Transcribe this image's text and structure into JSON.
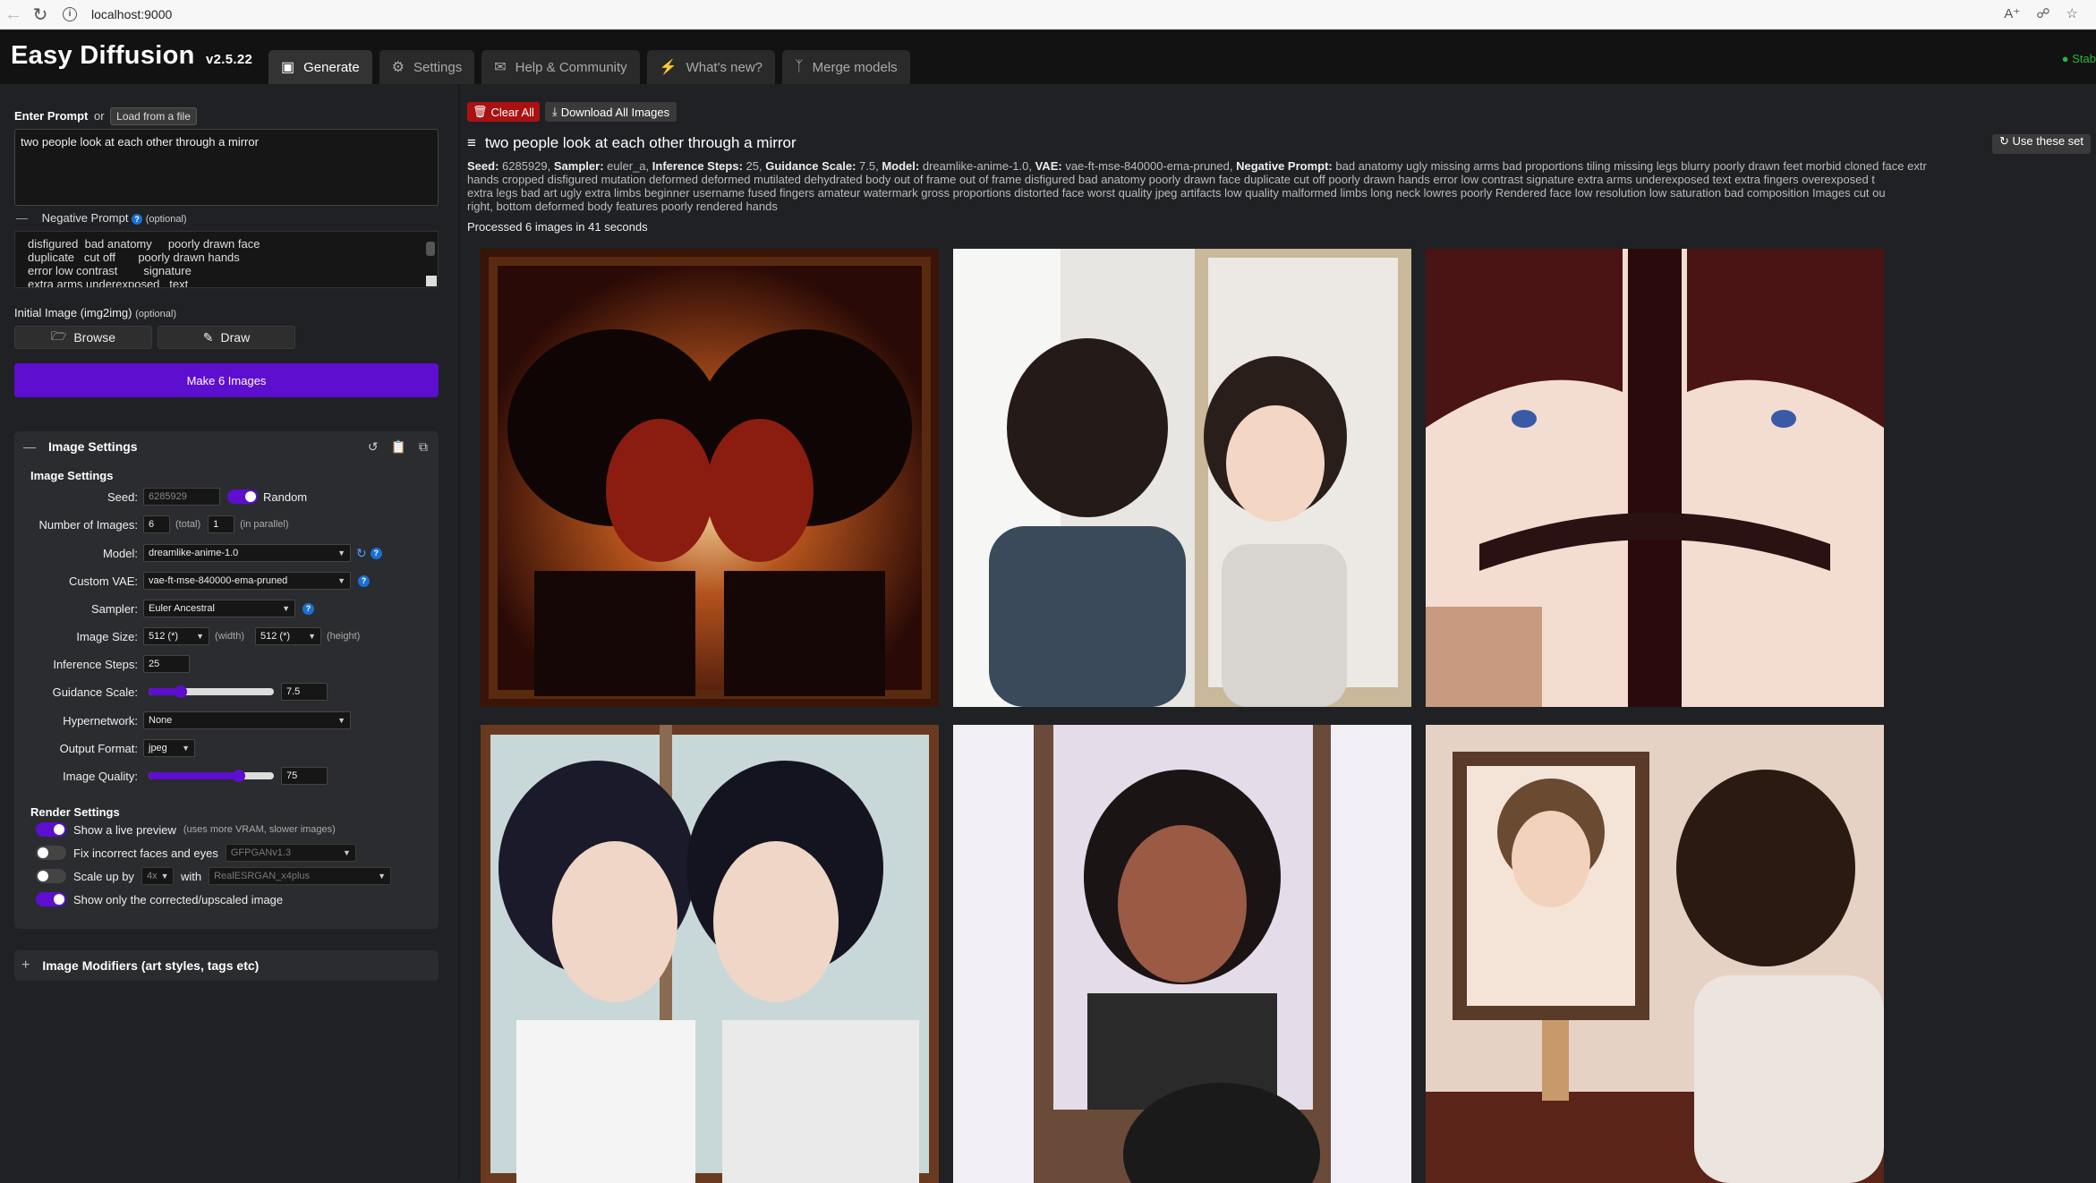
{
  "browser": {
    "url": "localhost:9000"
  },
  "app": {
    "name": "Easy Diffusion",
    "version": "v2.5.22",
    "status": "Stab"
  },
  "tabs": [
    {
      "label": "Generate",
      "icon": "image-icon"
    },
    {
      "label": "Settings",
      "icon": "gear-icon"
    },
    {
      "label": "Help & Community",
      "icon": "comments-icon"
    },
    {
      "label": "What's new?",
      "icon": "bolt-icon"
    },
    {
      "label": "Merge models",
      "icon": "merge-icon"
    }
  ],
  "prompt": {
    "label": "Enter Prompt",
    "or": "or",
    "load_button": "Load from a file",
    "value": "two people look at each other through a mirror"
  },
  "negative_prompt": {
    "label": "Negative Prompt",
    "optional": "(optional)",
    "value": "disfigured  bad anatomy     poorly drawn face\nduplicate   cut off       poorly drawn hands\nerror low contrast        signature\nextra arms underexposed   text"
  },
  "initial_image": {
    "label": "Initial Image (img2img)",
    "optional": "(optional)",
    "browse": "Browse",
    "draw": "Draw"
  },
  "make_button": "Make 6 Images",
  "image_settings": {
    "title": "Image Settings",
    "subtitle": "Image Settings",
    "seed_label": "Seed:",
    "seed": "6285929",
    "random_label": "Random",
    "num_images_label": "Number of Images:",
    "num_total": "6",
    "total_hint": "(total)",
    "num_parallel": "1",
    "parallel_hint": "(in parallel)",
    "model_label": "Model:",
    "model": "dreamlike-anime-1.0",
    "vae_label": "Custom VAE:",
    "vae": "vae-ft-mse-840000-ema-pruned",
    "sampler_label": "Sampler:",
    "sampler": "Euler Ancestral",
    "size_label": "Image Size:",
    "width": "512 (*)",
    "width_hint": "(width)",
    "height": "512 (*)",
    "height_hint": "(height)",
    "steps_label": "Inference Steps:",
    "steps": "25",
    "guidance_label": "Guidance Scale:",
    "guidance": "7.5",
    "guidance_fraction": 0.26,
    "hypernetwork_label": "Hypernetwork:",
    "hypernetwork": "None",
    "format_label": "Output Format:",
    "format": "jpeg",
    "quality_label": "Image Quality:",
    "quality": "75",
    "quality_fraction": 0.72
  },
  "render_settings": {
    "title": "Render Settings",
    "live_preview": "Show a live preview",
    "live_preview_hint": "(uses more VRAM, slower images)",
    "fix_faces": "Fix incorrect faces and eyes",
    "face_model": "GFPGANv1.3",
    "scale_up": "Scale up by",
    "scale_factor": "4x",
    "with": "with",
    "upscale_model": "RealESRGAN_x4plus",
    "show_only": "Show only the corrected/upscaled image"
  },
  "modifiers": {
    "title": "Image Modifiers (art styles, tags etc)"
  },
  "results": {
    "clear_all": "Clear All",
    "download_all": "Download All Images",
    "task_title": "two people look at each other through a mirror",
    "use_settings": "Use these set",
    "meta_seed_label": "Seed:",
    "meta_seed": "6285929,",
    "meta_sampler_label": "Sampler:",
    "meta_sampler": "euler_a,",
    "meta_steps_label": "Inference Steps:",
    "meta_steps": "25,",
    "meta_guidance_label": "Guidance Scale:",
    "meta_guidance": "7.5,",
    "meta_model_label": "Model:",
    "meta_model": "dreamlike-anime-1.0,",
    "meta_vae_label": "VAE:",
    "meta_vae": "vae-ft-mse-840000-ema-pruned,",
    "meta_neg_label": "Negative Prompt:",
    "meta_neg_line1": "bad anatomy ugly missing arms bad proportions tiling missing legs blurry poorly drawn feet morbid cloned face extr",
    "meta_neg_line2": "hands cropped disfigured mutation deformed deformed mutilated dehydrated body out of frame out of frame disfigured bad anatomy poorly drawn face duplicate cut off poorly drawn hands error low contrast signature extra arms underexposed text extra fingers overexposed t",
    "meta_neg_line3": "extra legs bad art ugly extra limbs beginner username fused fingers amateur watermark gross proportions distorted face worst quality jpeg artifacts low quality malformed limbs long neck lowres poorly Rendered face low resolution low saturation bad composition Images cut ou",
    "meta_neg_line4": "right, bottom deformed body features poorly rendered hands",
    "processed": "Processed 6 images in 41 seconds"
  },
  "colors": {
    "accent": "#5d0ecf",
    "danger": "#aa1111",
    "background": "#202124",
    "header": "#121212"
  }
}
